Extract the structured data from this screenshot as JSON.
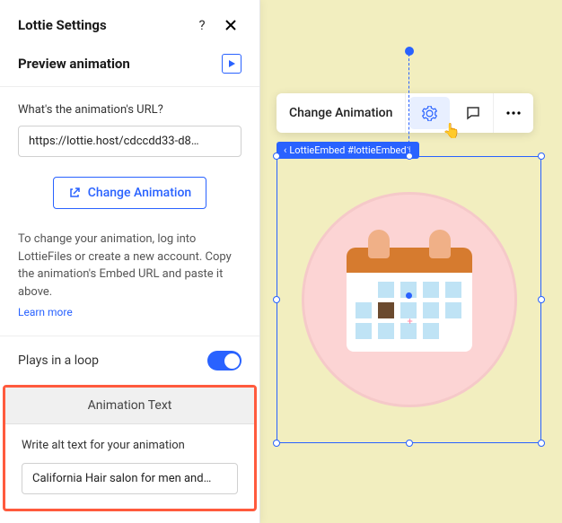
{
  "panel": {
    "title": "Lottie Settings",
    "preview_label": "Preview animation",
    "url_label": "What's the animation's URL?",
    "url_value": "https://lottie.host/cdccdd33-d8…",
    "change_btn": "Change Animation",
    "help_text": "To change your animation, log into LottieFiles or create a new account. Copy the animation's Embed URL and paste it above.",
    "learn_more": "Learn more",
    "loop_label": "Plays in a loop",
    "anim_text_header": "Animation Text",
    "alt_label": "Write alt text for your animation",
    "alt_value": "California Hair salon for men and…"
  },
  "canvas": {
    "toolbar_change": "Change Animation",
    "badge": "LottieEmbed #lottieEmbed1"
  }
}
